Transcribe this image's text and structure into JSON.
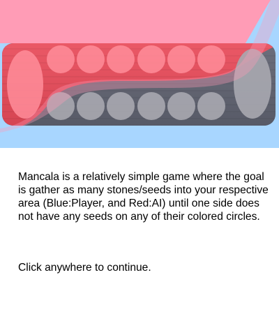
{
  "colors": {
    "player_blue": "#a8d6ff",
    "ai_red": "#ff9cb6",
    "board_gray": "#5f6270",
    "board_red": "#e84a59",
    "pit_light": "#cfcfd4"
  },
  "board": {
    "ai_store_label": "",
    "player_store_label": "",
    "pits_per_row": 6
  },
  "instructions": {
    "text": "Mancala is a relatively simple game where the goal is gather as many stones/seeds into your respective area (Blue:Player, and Red:AI) until one side does not have any seeds on any of their colored circles.",
    "continue": "Click anywhere to continue."
  }
}
